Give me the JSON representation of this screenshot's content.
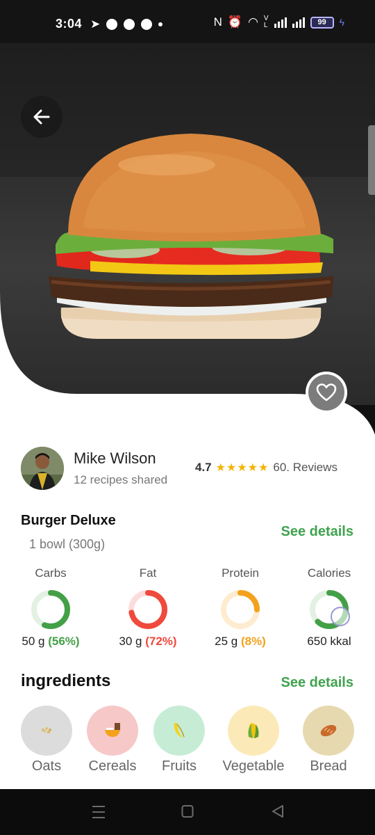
{
  "status_bar": {
    "time": "3:04",
    "battery": "99"
  },
  "hero": {
    "back_icon": "arrow-left-icon",
    "favorite_icon": "heart-icon"
  },
  "author": {
    "name": "Mike Wilson",
    "subtitle": "12 recipes shared"
  },
  "rating": {
    "score": "4.7",
    "stars": "★★★★★",
    "reviews": "60. Reviews"
  },
  "recipe": {
    "title": "Burger Deluxe",
    "serving": "1 bowl (300g)",
    "see_details": "See details"
  },
  "nutrition": [
    {
      "label": "Carbs",
      "amount": "50 g",
      "percent": "(56%)",
      "fraction": 0.56,
      "color": "#43a047",
      "track": "#e3f1e3"
    },
    {
      "label": "Fat",
      "amount": "30 g",
      "percent": "(72%)",
      "fraction": 0.72,
      "color": "#ef4a3c",
      "track": "#fbdcdc"
    },
    {
      "label": "Protein",
      "amount": "25 g",
      "percent": "(8%)",
      "fraction": 0.25,
      "color": "#f2a21c",
      "track": "#fdecd0"
    },
    {
      "label": "Calories",
      "amount": "650 kkal",
      "percent": "",
      "fraction": 0.62,
      "color": "#43a047",
      "track": "#e3f1e3"
    }
  ],
  "ingredients": {
    "title": "ingredients",
    "see_details": "See details",
    "items": [
      {
        "label": "Oats",
        "icon": "oats-icon",
        "bg": "#dcdcdc"
      },
      {
        "label": "Cereals",
        "icon": "cereal-bowl-icon",
        "bg": "#f6c8c8"
      },
      {
        "label": "Fruits",
        "icon": "banana-icon",
        "bg": "#c6ecd6"
      },
      {
        "label": "Vegetable",
        "icon": "corn-icon",
        "bg": "#fbeab8"
      },
      {
        "label": "Bread",
        "icon": "bread-icon",
        "bg": "#e6d9b0"
      }
    ]
  },
  "navbar": {
    "menu_icon": "recent-apps-icon",
    "home_icon": "home-icon",
    "back_icon": "back-triangle-icon"
  }
}
